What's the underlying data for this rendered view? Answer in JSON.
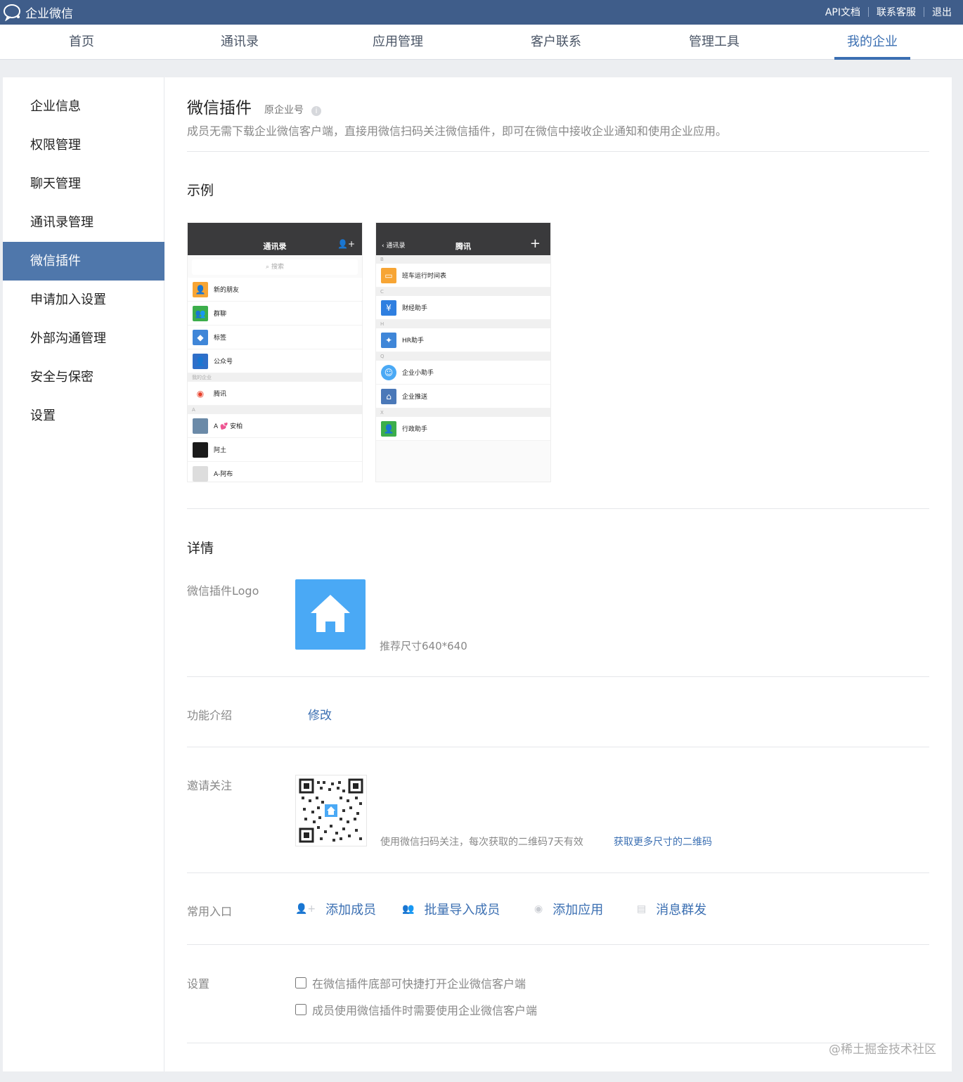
{
  "topbar": {
    "brand": "企业微信",
    "links": [
      "API文档",
      "联系客服",
      "退出"
    ]
  },
  "nav": {
    "items": [
      "首页",
      "通讯录",
      "应用管理",
      "客户联系",
      "管理工具",
      "我的企业"
    ],
    "active": "我的企业"
  },
  "sidebar": {
    "items": [
      "企业信息",
      "权限管理",
      "聊天管理",
      "通讯录管理",
      "微信插件",
      "申请加入设置",
      "外部沟通管理",
      "安全与保密",
      "设置"
    ],
    "active": "微信插件"
  },
  "header": {
    "title": "微信插件",
    "subtitle": "原企业号",
    "desc": "成员无需下载企业微信客户端，直接用微信扫码关注微信插件，即可在微信中接收企业通知和使用企业应用。"
  },
  "example": {
    "title": "示例",
    "phone1": {
      "title": "通讯录",
      "search": "搜索",
      "rows": [
        "新的朋友",
        "群聊",
        "标签",
        "公众号"
      ],
      "group1": "我的企业",
      "company": "腾讯",
      "group2": "A",
      "contacts": [
        "A 💕 安柏",
        "阿土",
        "A-阿布"
      ]
    },
    "phone2": {
      "back": "通讯录",
      "title": "腾讯",
      "plus": "+",
      "groups": [
        "B",
        "C",
        "H",
        "Q",
        "X"
      ],
      "rows": [
        "班车运行时间表",
        "财经助手",
        "HR助手",
        "企业小助手",
        "企业推送",
        "行政助手"
      ]
    }
  },
  "details": {
    "title": "详情",
    "logo_label": "微信插件Logo",
    "logo_hint": "推荐尺寸640*640",
    "intro_label": "功能介绍",
    "intro_edit": "修改",
    "invite_label": "邀请关注",
    "invite_hint": "使用微信扫码关注，每次获取的二维码7天有效",
    "invite_link": "获取更多尺寸的二维码",
    "entry_label": "常用入口",
    "entries": [
      "添加成员",
      "批量导入成员",
      "添加应用",
      "消息群发"
    ],
    "settings_label": "设置",
    "settings": [
      {
        "text": "在微信插件底部可快捷打开企业微信客户端",
        "checked": false
      },
      {
        "text": "成员使用微信插件时需要使用企业微信客户端",
        "checked": false
      }
    ]
  },
  "colors": {
    "topbar": "#3f5d8a",
    "accent": "#3b6fb2",
    "sidebar_active": "#4f77ab",
    "logo_bg": "#4aa9f5"
  },
  "watermark": "@稀土掘金技术社区"
}
